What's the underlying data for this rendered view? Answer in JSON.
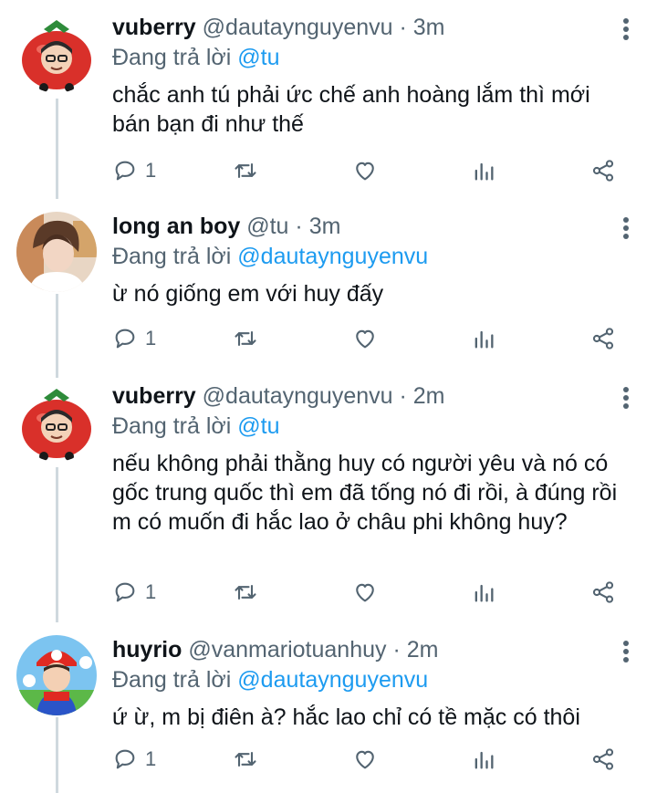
{
  "tweets": [
    {
      "name": "vuberry",
      "handle": "@dautaynguyenvu",
      "dot": "·",
      "time": "3m",
      "reply_prefix": "Đang trả lời",
      "reply_to": "@tu",
      "text": "chắc anh tú phải ức chế anh hoàng lắm thì mới bán bạn đi như thế",
      "reply_count": "1",
      "avatar": "tomato-avatar"
    },
    {
      "name": "long an boy",
      "handle": "@tu",
      "dot": "·",
      "time": "3m",
      "reply_prefix": "Đang trả lời",
      "reply_to": "@dautaynguyenvu",
      "text": "ừ nó giống em với huy đấy",
      "reply_count": "1",
      "avatar": "person-avatar"
    },
    {
      "name": "vuberry",
      "handle": "@dautaynguyenvu",
      "dot": "·",
      "time": "2m",
      "reply_prefix": "Đang trả lời",
      "reply_to": "@tu",
      "text": "nếu không phải thằng huy có người yêu và nó có gốc trung quốc thì em đã tống nó đi rồi, à đúng rồi m có muốn đi hắc lao ở châu phi không huy?",
      "reply_count": "1",
      "avatar": "tomato-avatar"
    },
    {
      "name": "huyrio",
      "handle": "@vanmariotuanhuy",
      "dot": "·",
      "time": "2m",
      "reply_prefix": "Đang trả lời",
      "reply_to": "@dautaynguyenvu",
      "text": "ứ ừ, m bị điên à? hắc lao chỉ có tề mặc có thôi",
      "reply_count": "1",
      "avatar": "mario-avatar"
    }
  ],
  "icons": {
    "reply": "reply-icon",
    "retweet": "retweet-icon",
    "like": "heart-icon",
    "views": "analytics-icon",
    "share": "share-icon",
    "more": "more-vertical-icon"
  },
  "colors": {
    "text": "#0f1419",
    "secondary": "#536471",
    "mention": "#1d9bf0",
    "thread_line": "#cfd9de"
  }
}
